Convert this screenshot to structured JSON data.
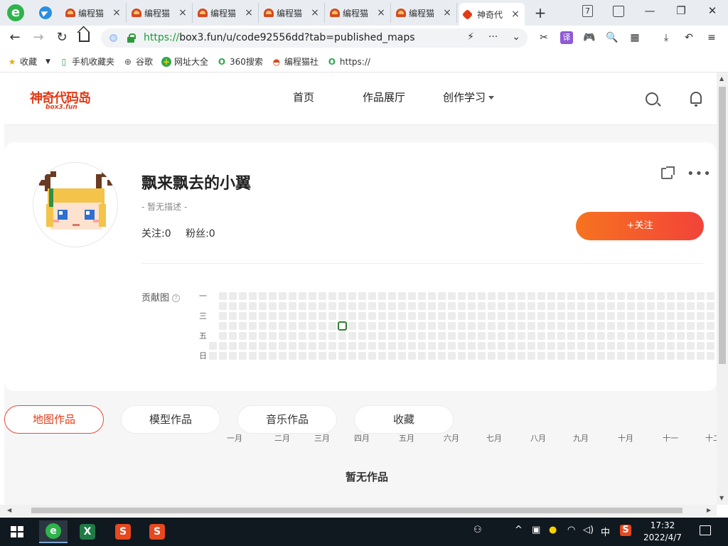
{
  "browser": {
    "tabs": [
      {
        "label": "编程猫"
      },
      {
        "label": "编程猫"
      },
      {
        "label": "编程猫"
      },
      {
        "label": "编程猫"
      },
      {
        "label": "编程猫"
      },
      {
        "label": "编程猫"
      },
      {
        "label": "神奇代"
      }
    ],
    "new_tab": "+",
    "tab_count": "7",
    "url_prefix": "https://",
    "url_host": "box3.fun",
    "url_path": "/u/code92556dd?tab=published_maps",
    "translate_label": "译"
  },
  "bookmarks": [
    {
      "label": "收藏",
      "icon": "star-icon"
    },
    {
      "label": "手机收藏夹",
      "icon": "phone-icon"
    },
    {
      "label": "谷歌",
      "icon": "globe-icon"
    },
    {
      "label": "网址大全",
      "icon": "plus-circle-icon"
    },
    {
      "label": "360搜索",
      "icon": "search-icon"
    },
    {
      "label": "编程猫社",
      "icon": "codemao-icon"
    },
    {
      "label": "https://",
      "icon": "search-icon"
    }
  ],
  "site": {
    "logo_main": "神奇代码岛",
    "logo_sub": "box3.fun",
    "nav": {
      "home": "首页",
      "gallery": "作品展厅",
      "learn": "创作学习"
    }
  },
  "profile": {
    "name": "飘来飘去的小翼",
    "description": "- 暂无描述 -",
    "following": "关注:0",
    "followers": "粉丝:0",
    "follow_label": "+关注",
    "contrib_label": "贡献图",
    "help": "?",
    "day_labels": [
      "一",
      "三",
      "五",
      "日"
    ],
    "months": [
      "一月",
      "二月",
      "三月",
      "四月",
      "五月",
      "六月",
      "七月",
      "八月",
      "九月",
      "十月",
      "十一",
      "十二"
    ],
    "activity_day": {
      "week": 13,
      "weekday": 3
    }
  },
  "tabs": {
    "maps": "地图作品",
    "models": "模型作品",
    "music": "音乐作品",
    "favorites": "收藏"
  },
  "empty": "暂无作品",
  "taskbar": {
    "ime": "中",
    "time": "17:32",
    "date": "2022/4/7"
  },
  "colors": {
    "brand": "#e23b18",
    "follow_gradient_start": "#f7731f",
    "follow_gradient_end": "#f2433a",
    "activity": "#2f7d32"
  }
}
